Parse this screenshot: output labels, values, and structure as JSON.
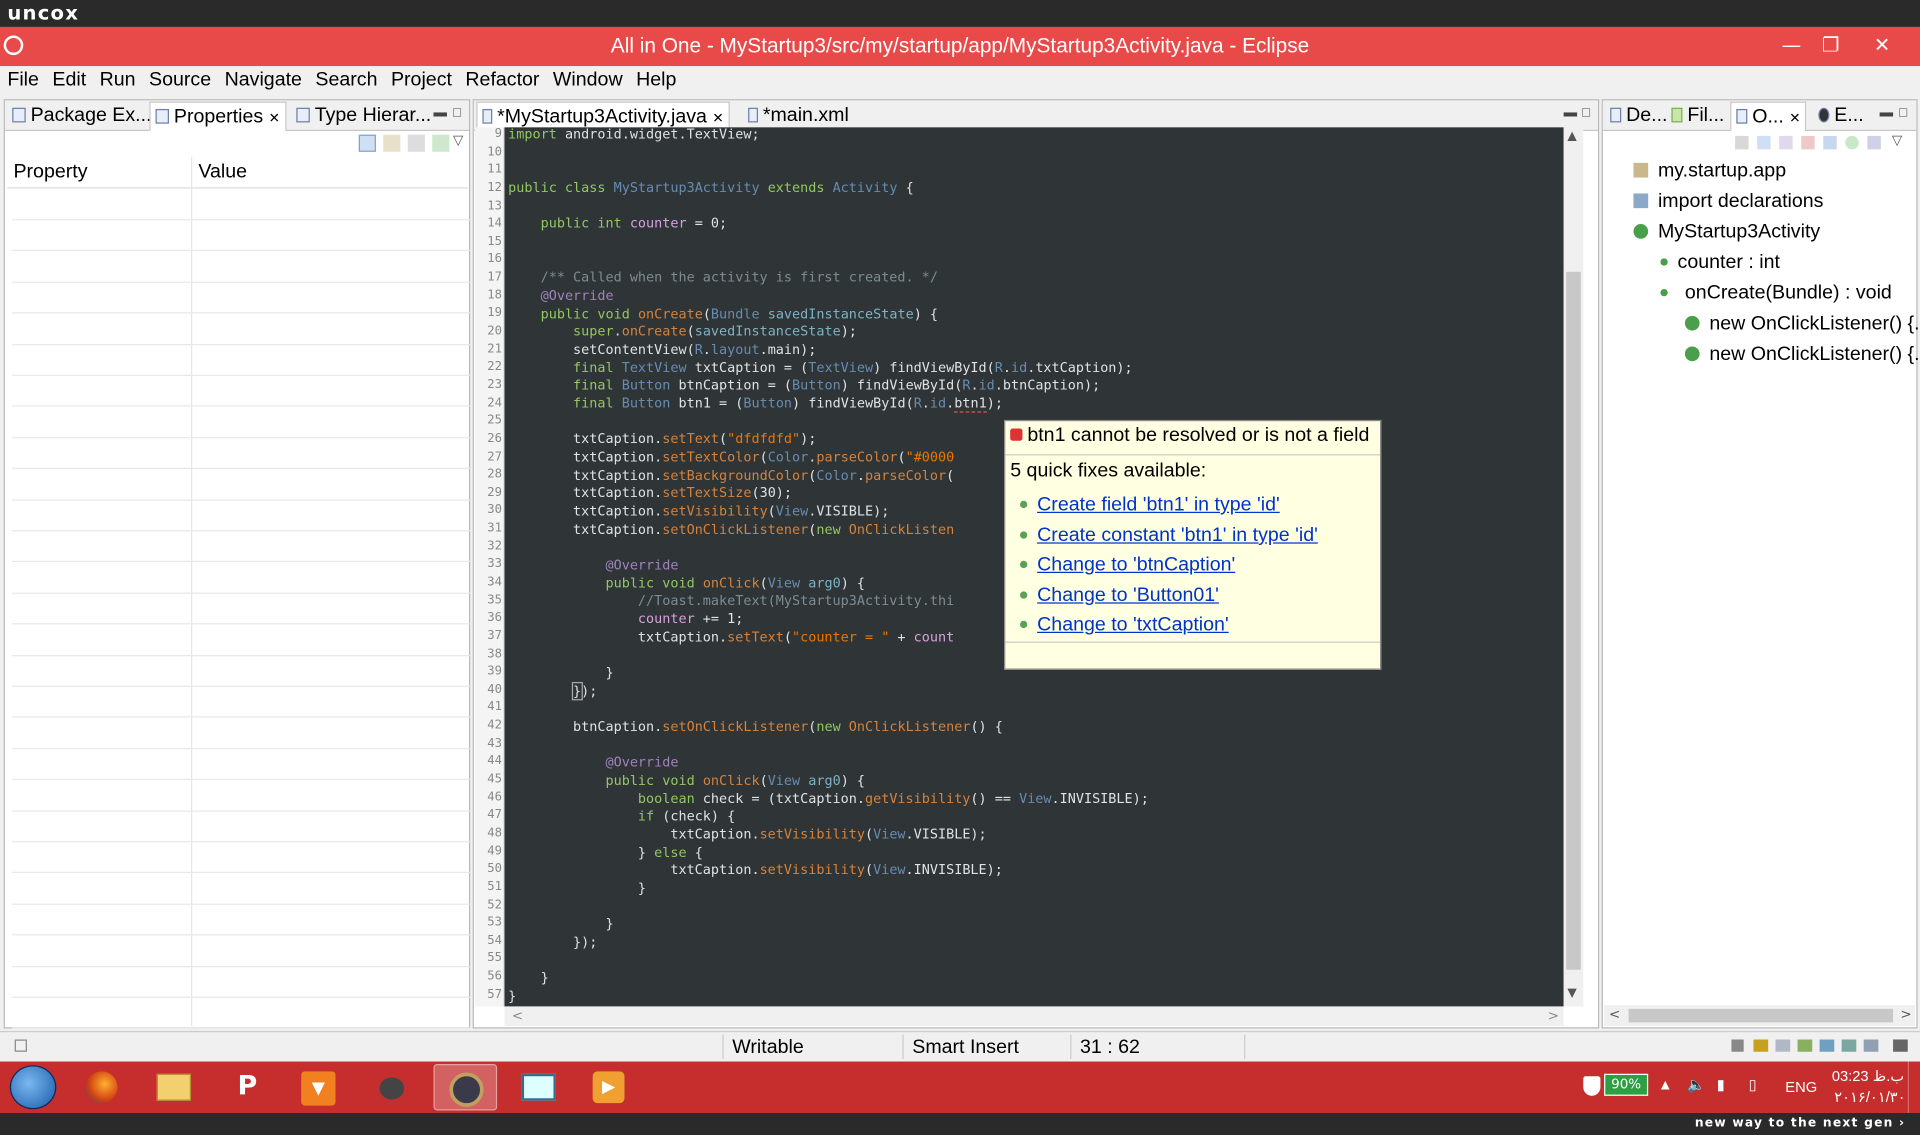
{
  "top_strip": {
    "brand": "uncox"
  },
  "window": {
    "title": "All in One - MyStartup3/src/my/startup/app/MyStartup3Activity.java - Eclipse"
  },
  "menu": [
    "File",
    "Edit",
    "Run",
    "Source",
    "Navigate",
    "Search",
    "Project",
    "Refactor",
    "Window",
    "Help"
  ],
  "left_panel": {
    "tabs": [
      "Package Ex...",
      "Properties",
      "Type Hierar..."
    ],
    "active_tab": "Properties",
    "columns": [
      "Property",
      "Value"
    ]
  },
  "editor": {
    "tabs": [
      "*MyStartup3Activity.java",
      "*main.xml"
    ],
    "active_tab": "*MyStartup3Activity.java",
    "line_numbers": [
      "9",
      "10",
      "11",
      "12",
      "13",
      "14",
      "15",
      "16",
      "17",
      "18",
      "19",
      "20",
      "21",
      "22",
      "23",
      "24",
      "25",
      "26",
      "27",
      "28",
      "29",
      "30",
      "31",
      "32",
      "33",
      "34",
      "35",
      "36",
      "37",
      "38",
      "39",
      "40",
      "41",
      "42",
      "43",
      "44",
      "45",
      "46",
      "47",
      "48",
      "49",
      "50",
      "51",
      "52",
      "53",
      "54",
      "55",
      "56",
      "57"
    ]
  },
  "tooltip": {
    "message": "btn1 cannot be resolved or is not a field",
    "quick_fix_count": "5 quick fixes available:",
    "fixes": [
      "Create field 'btn1' in type 'id'",
      "Create constant 'btn1' in type 'id'",
      "Change to 'btnCaption'",
      "Change to 'Button01'",
      "Change to 'txtCaption'"
    ]
  },
  "right_panel": {
    "tabs": [
      "De...",
      "Fil...",
      "O...",
      "E..."
    ],
    "active_tab": "O...",
    "outline": [
      "my.startup.app",
      "import declarations",
      "MyStartup3Activity",
      "counter : int",
      "onCreate(Bundle) : void",
      "new OnClickListener() {...",
      "new OnClickListener() {..."
    ]
  },
  "status": {
    "writable": "Writable",
    "insert_mode": "Smart Insert",
    "position": "31 : 62"
  },
  "taskbar": {
    "battery": "90%",
    "language": "ENG",
    "time": "03:23 ب.ظ",
    "date": "۲۰۱۶/۰۱/۳۰"
  },
  "bottom_strip": {
    "slogan": "new way to the next gen ›"
  },
  "colors": {
    "titlebar": "#e84a4a",
    "taskbar": "#c62d2d",
    "editor_bg": "#2f3436",
    "tooltip_bg": "#ffffe1"
  }
}
